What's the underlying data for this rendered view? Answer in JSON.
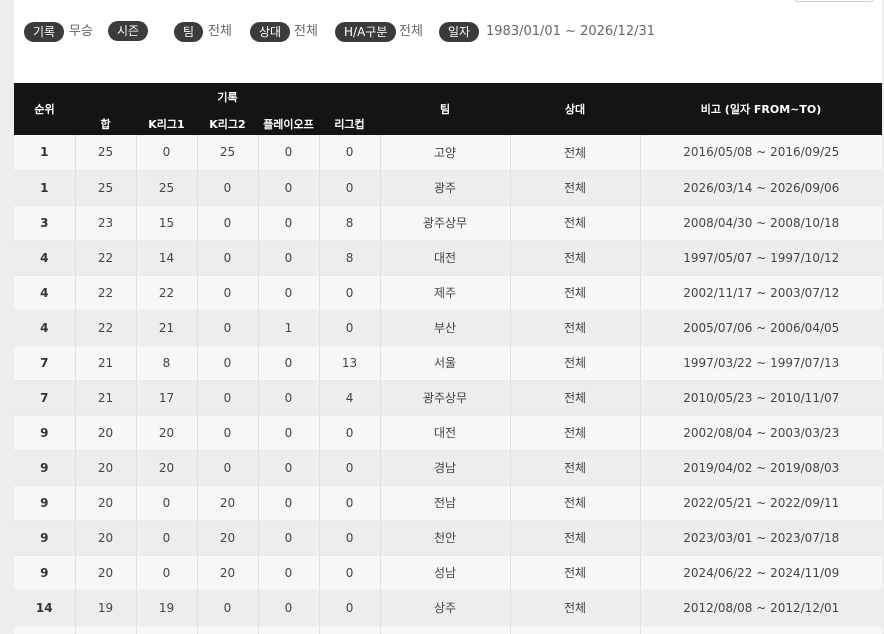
{
  "filters": [
    {
      "label": "기록",
      "value": "무승"
    },
    {
      "label": "시즌",
      "value": ""
    },
    {
      "label": "팀",
      "value": "전체"
    },
    {
      "label": "상대",
      "value": "전체"
    },
    {
      "label": "H/A구분",
      "value": "전체"
    },
    {
      "label": "일자",
      "value": "1983/01/01 ~ 2026/12/31"
    }
  ],
  "table": {
    "headers": {
      "rank": "순위",
      "record_group": "기록",
      "total": "합",
      "k1": "K리그1",
      "k2": "K리그2",
      "playoff": "플레이오프",
      "cup": "리그컵",
      "team": "팀",
      "opponent": "상대",
      "note": "비고 (일자 FROM~TO)"
    },
    "rows": [
      {
        "rank": "1",
        "total": "25",
        "k1": "0",
        "k2": "25",
        "playoff": "0",
        "cup": "0",
        "team": "고양",
        "opponent": "전체",
        "note": "2016/05/08 ~ 2016/09/25"
      },
      {
        "rank": "1",
        "total": "25",
        "k1": "25",
        "k2": "0",
        "playoff": "0",
        "cup": "0",
        "team": "광주",
        "opponent": "전체",
        "note": "2026/03/14 ~ 2026/09/06"
      },
      {
        "rank": "3",
        "total": "23",
        "k1": "15",
        "k2": "0",
        "playoff": "0",
        "cup": "8",
        "team": "광주상무",
        "opponent": "전체",
        "note": "2008/04/30 ~ 2008/10/18"
      },
      {
        "rank": "4",
        "total": "22",
        "k1": "14",
        "k2": "0",
        "playoff": "0",
        "cup": "8",
        "team": "대전",
        "opponent": "전체",
        "note": "1997/05/07 ~ 1997/10/12"
      },
      {
        "rank": "4",
        "total": "22",
        "k1": "22",
        "k2": "0",
        "playoff": "0",
        "cup": "0",
        "team": "제주",
        "opponent": "전체",
        "note": "2002/11/17 ~ 2003/07/12"
      },
      {
        "rank": "4",
        "total": "22",
        "k1": "21",
        "k2": "0",
        "playoff": "1",
        "cup": "0",
        "team": "부산",
        "opponent": "전체",
        "note": "2005/07/06 ~ 2006/04/05"
      },
      {
        "rank": "7",
        "total": "21",
        "k1": "8",
        "k2": "0",
        "playoff": "0",
        "cup": "13",
        "team": "서울",
        "opponent": "전체",
        "note": "1997/03/22 ~ 1997/07/13"
      },
      {
        "rank": "7",
        "total": "21",
        "k1": "17",
        "k2": "0",
        "playoff": "0",
        "cup": "4",
        "team": "광주상무",
        "opponent": "전체",
        "note": "2010/05/23 ~ 2010/11/07"
      },
      {
        "rank": "9",
        "total": "20",
        "k1": "20",
        "k2": "0",
        "playoff": "0",
        "cup": "0",
        "team": "대전",
        "opponent": "전체",
        "note": "2002/08/04 ~ 2003/03/23"
      },
      {
        "rank": "9",
        "total": "20",
        "k1": "20",
        "k2": "0",
        "playoff": "0",
        "cup": "0",
        "team": "경남",
        "opponent": "전체",
        "note": "2019/04/02 ~ 2019/08/03"
      },
      {
        "rank": "9",
        "total": "20",
        "k1": "0",
        "k2": "20",
        "playoff": "0",
        "cup": "0",
        "team": "전남",
        "opponent": "전체",
        "note": "2022/05/21 ~ 2022/09/11"
      },
      {
        "rank": "9",
        "total": "20",
        "k1": "0",
        "k2": "20",
        "playoff": "0",
        "cup": "0",
        "team": "천안",
        "opponent": "전체",
        "note": "2023/03/01 ~ 2023/07/18"
      },
      {
        "rank": "9",
        "total": "20",
        "k1": "0",
        "k2": "20",
        "playoff": "0",
        "cup": "0",
        "team": "성남",
        "opponent": "전체",
        "note": "2024/06/22 ~ 2024/11/09"
      },
      {
        "rank": "14",
        "total": "19",
        "k1": "19",
        "k2": "0",
        "playoff": "0",
        "cup": "0",
        "team": "상주",
        "opponent": "전체",
        "note": "2012/08/08 ~ 2012/12/01"
      },
      {
        "rank": "",
        "total": "",
        "k1": "",
        "k2": "",
        "playoff": "",
        "cup": "",
        "team": "",
        "opponent": "",
        "note": ""
      }
    ]
  }
}
